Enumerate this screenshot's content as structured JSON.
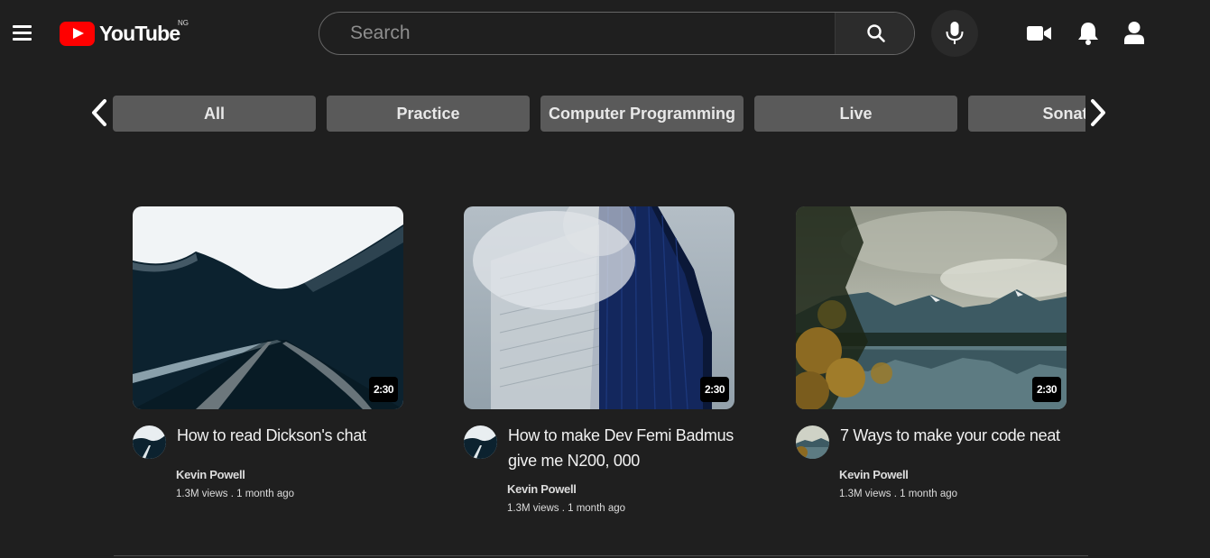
{
  "header": {
    "logo_text": "YouTube",
    "country_code": "NG",
    "search_placeholder": "Search",
    "icons": [
      "menu-icon",
      "search-icon",
      "microphone-icon",
      "video-camera-icon",
      "bell-icon",
      "user-icon"
    ]
  },
  "chips": [
    "All",
    "Practice",
    "Computer Programming",
    "Live",
    "Sonata"
  ],
  "videos": [
    {
      "title": "How to read Dickson's chat",
      "channel": "Kevin Powell",
      "stats": "1.3M views . 1 month ago",
      "duration": "2:30"
    },
    {
      "title": "How to make Dev Femi Badmus give me N200, 000",
      "channel": "Kevin Powell",
      "stats": "1.3M views . 1 month ago",
      "duration": "2:30"
    },
    {
      "title": "7 Ways to make your code neat",
      "channel": "Kevin Powell",
      "stats": "1.3M views . 1 month ago",
      "duration": "2:30"
    }
  ],
  "colors": {
    "background": "#1f1f1f",
    "brand_red": "#ff0000",
    "chip_bg": "#5a5a5a"
  }
}
